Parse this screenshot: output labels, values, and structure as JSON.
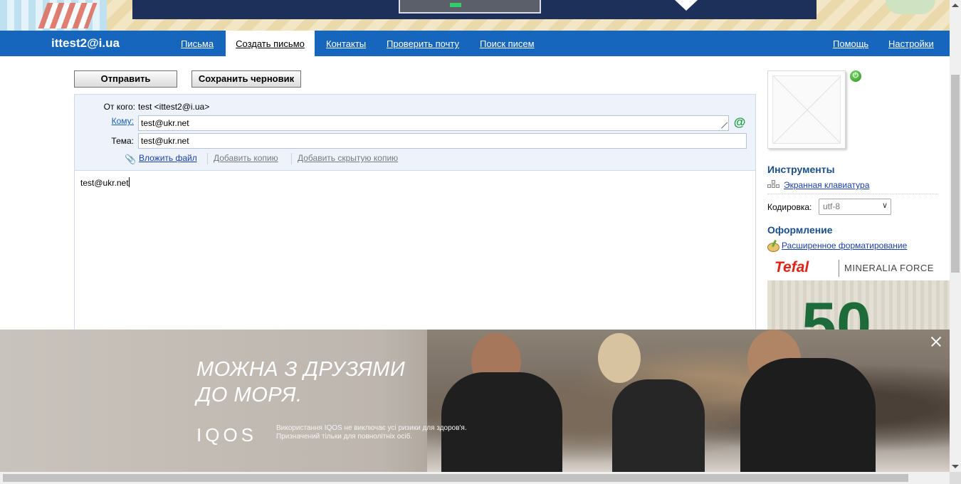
{
  "header": {
    "account": "ittest2@i.ua",
    "nav": [
      "Письма",
      "Создать письмо",
      "Контакты",
      "Проверить почту",
      "Поиск писем"
    ],
    "active_tab": "Создать письмо",
    "right_nav": [
      "Помощь",
      "Настройки"
    ]
  },
  "toolbar": {
    "send_label": "Отправить",
    "save_draft_label": "Сохранить черновик"
  },
  "compose": {
    "from_label": "От кого:",
    "from_value": "test <ittest2@i.ua>",
    "to_label": "Кому:",
    "to_value": "test@ukr.net",
    "subject_label": "Тема:",
    "subject_value": "test@ukr.net",
    "attach_label": "Вложить файл",
    "add_cc_label": "Добавить копию",
    "add_bcc_label": "Добавить скрытую копию",
    "body_text": "test@ukr.net"
  },
  "sidebar": {
    "tools_heading": "Инструменты",
    "virtual_keyboard_label": "Экранная клавиатура",
    "encoding_label": "Кодировка:",
    "encoding_value": "utf-8",
    "design_heading": "Оформление",
    "advanced_formatting_label": "Расширенное форматирование"
  },
  "ads": {
    "tefal_brand": "Tefal",
    "tefal_product": "MINERALIA FORCE",
    "tefal_big": "50",
    "iqos_headline_line1": "МОЖНА З ДРУЗЯМИ",
    "iqos_headline_line2": "ДО МОРЯ.",
    "iqos_brand": "IQOS",
    "iqos_disclaimer": "Використання IQOS не виключає усі ризики для здоров'я. Призначений тільки для повнолітніх осіб."
  },
  "icons": {
    "power": "power-icon",
    "contacts_at": "at-icon",
    "attach": "paperclip-icon",
    "keyboard": "keyboard-icon",
    "palette": "palette-icon",
    "close": "close-icon"
  },
  "colors": {
    "navbar": "#1566bc",
    "link": "#1a3fa5",
    "heading": "#1a4f8b",
    "compose_bg": "#eef3fb"
  }
}
